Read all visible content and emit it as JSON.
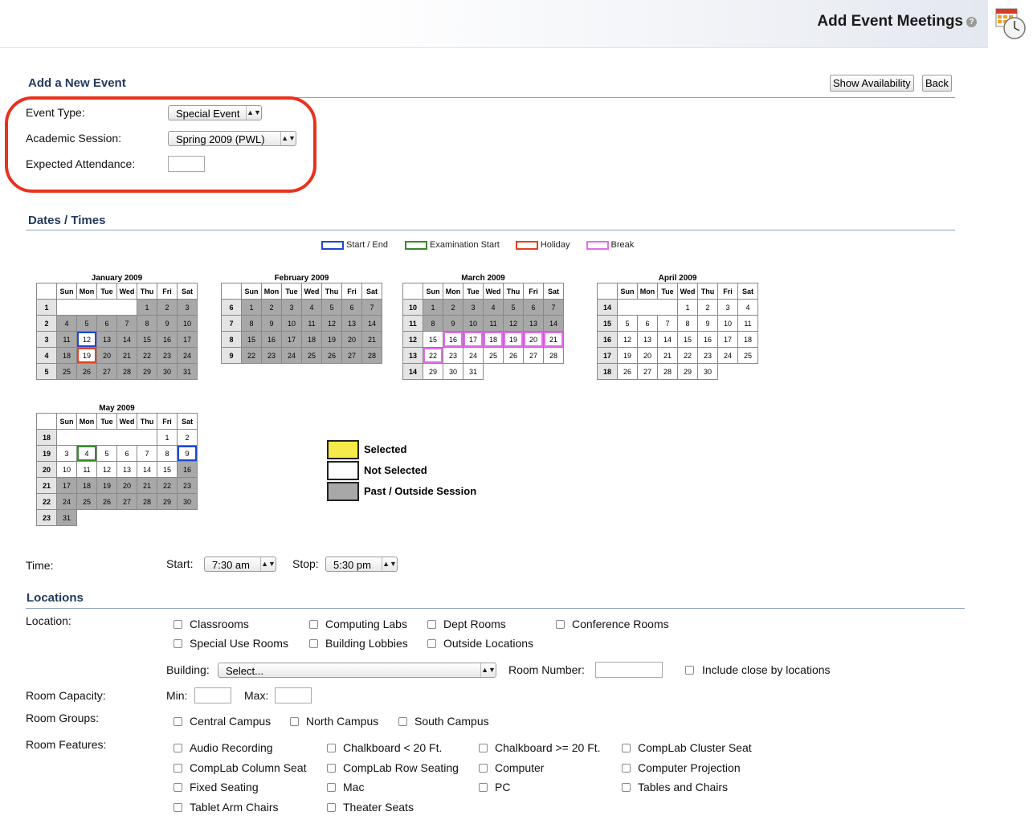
{
  "header": {
    "title": "Add Event Meetings",
    "help_icon": "?"
  },
  "section1": {
    "title": "Add a New Event",
    "show_availability": "Show Availability",
    "back": "Back",
    "event_type_label": "Event Type:",
    "event_type_value": "Special Event",
    "academic_session_label": "Academic Session:",
    "academic_session_value": "Spring 2009 (PWL)",
    "expected_attendance_label": "Expected Attendance:",
    "expected_attendance_value": "",
    "highlight_color": "#e8321e"
  },
  "dates": {
    "title": "Dates / Times",
    "legend": [
      {
        "label": "Start / End",
        "color": "#1e47d8"
      },
      {
        "label": "Examination Start",
        "color": "#3a8a2a"
      },
      {
        "label": "Holiday",
        "color": "#e4421e"
      },
      {
        "label": "Break",
        "color": "#e06fe8"
      }
    ],
    "day_headers": [
      "Sun",
      "Mon",
      "Tue",
      "Wed",
      "Thu",
      "Fri",
      "Sat"
    ],
    "calendars": [
      {
        "title": "January 2009",
        "rows": [
          {
            "wk": "1",
            "days": [
              "",
              "",
              "",
              "",
              "1",
              "2",
              "3"
            ]
          },
          {
            "wk": "2",
            "days": [
              "4",
              "5",
              "6",
              "7",
              "8",
              "9",
              "10"
            ]
          },
          {
            "wk": "3",
            "days": [
              "11",
              "12",
              "13",
              "14",
              "15",
              "16",
              "17"
            ]
          },
          {
            "wk": "4",
            "days": [
              "18",
              "19",
              "20",
              "21",
              "22",
              "23",
              "24"
            ]
          },
          {
            "wk": "5",
            "days": [
              "25",
              "26",
              "27",
              "28",
              "29",
              "30",
              "31"
            ]
          }
        ]
      },
      {
        "title": "February 2009",
        "rows": [
          {
            "wk": "6",
            "days": [
              "1",
              "2",
              "3",
              "4",
              "5",
              "6",
              "7"
            ]
          },
          {
            "wk": "7",
            "days": [
              "8",
              "9",
              "10",
              "11",
              "12",
              "13",
              "14"
            ]
          },
          {
            "wk": "8",
            "days": [
              "15",
              "16",
              "17",
              "18",
              "19",
              "20",
              "21"
            ]
          },
          {
            "wk": "9",
            "days": [
              "22",
              "23",
              "24",
              "25",
              "26",
              "27",
              "28"
            ]
          }
        ]
      },
      {
        "title": "March 2009",
        "rows": [
          {
            "wk": "10",
            "days": [
              "1",
              "2",
              "3",
              "4",
              "5",
              "6",
              "7"
            ]
          },
          {
            "wk": "11",
            "days": [
              "8",
              "9",
              "10",
              "11",
              "12",
              "13",
              "14"
            ]
          },
          {
            "wk": "12",
            "days": [
              "15",
              "16",
              "17",
              "18",
              "19",
              "20",
              "21"
            ]
          },
          {
            "wk": "13",
            "days": [
              "22",
              "23",
              "24",
              "25",
              "26",
              "27",
              "28"
            ]
          },
          {
            "wk": "14",
            "days": [
              "29",
              "30",
              "31",
              "",
              "",
              "",
              ""
            ]
          }
        ]
      },
      {
        "title": "April 2009",
        "rows": [
          {
            "wk": "14",
            "days": [
              "",
              "",
              "",
              "1",
              "2",
              "3",
              "4"
            ]
          },
          {
            "wk": "15",
            "days": [
              "5",
              "6",
              "7",
              "8",
              "9",
              "10",
              "11"
            ]
          },
          {
            "wk": "16",
            "days": [
              "12",
              "13",
              "14",
              "15",
              "16",
              "17",
              "18"
            ]
          },
          {
            "wk": "17",
            "days": [
              "19",
              "20",
              "21",
              "22",
              "23",
              "24",
              "25"
            ]
          },
          {
            "wk": "18",
            "days": [
              "26",
              "27",
              "28",
              "29",
              "30",
              "",
              ""
            ]
          }
        ]
      },
      {
        "title": "May 2009",
        "rows": [
          {
            "wk": "18",
            "days": [
              "",
              "",
              "",
              "",
              "",
              "1",
              "2"
            ]
          },
          {
            "wk": "19",
            "days": [
              "3",
              "4",
              "5",
              "6",
              "7",
              "8",
              "9"
            ]
          },
          {
            "wk": "20",
            "days": [
              "10",
              "11",
              "12",
              "13",
              "14",
              "15",
              "16"
            ]
          },
          {
            "wk": "21",
            "days": [
              "17",
              "18",
              "19",
              "20",
              "21",
              "22",
              "23"
            ]
          },
          {
            "wk": "22",
            "days": [
              "24",
              "25",
              "26",
              "27",
              "28",
              "29",
              "30"
            ]
          },
          {
            "wk": "23",
            "days": [
              "31",
              "",
              "",
              "",
              "",
              "",
              ""
            ]
          }
        ]
      }
    ],
    "key": [
      {
        "label": "Selected",
        "color": "#f5ea4a"
      },
      {
        "label": "Not Selected",
        "color": "#ffffff"
      },
      {
        "label": "Past / Outside Session",
        "color": "#a8a8a8"
      }
    ]
  },
  "time": {
    "label": "Time:",
    "start_label": "Start:",
    "start_value": "7:30 am",
    "stop_label": "Stop:",
    "stop_value": "5:30 pm"
  },
  "locations": {
    "title": "Locations",
    "location_label": "Location:",
    "location_types": [
      "Classrooms",
      "Computing Labs",
      "Dept Rooms",
      "Conference Rooms",
      "Special Use Rooms",
      "Building Lobbies",
      "Outside Locations"
    ],
    "building_label": "Building:",
    "building_value": "Select...",
    "room_number_label": "Room Number:",
    "include_close": "Include close by locations",
    "capacity_label": "Room Capacity:",
    "min_label": "Min:",
    "max_label": "Max:",
    "groups_label": "Room Groups:",
    "groups": [
      "Central Campus",
      "North Campus",
      "South Campus"
    ],
    "features_label": "Room Features:",
    "features": [
      "Audio Recording",
      "Chalkboard < 20 Ft.",
      "Chalkboard >= 20 Ft.",
      "CompLab Cluster Seat",
      "CompLab Column Seat",
      "CompLab Row Seating",
      "Computer",
      "Computer Projection",
      "Fixed Seating",
      "Mac",
      "PC",
      "Tables and Chairs",
      "Tablet Arm Chairs",
      "Theater Seats"
    ]
  }
}
